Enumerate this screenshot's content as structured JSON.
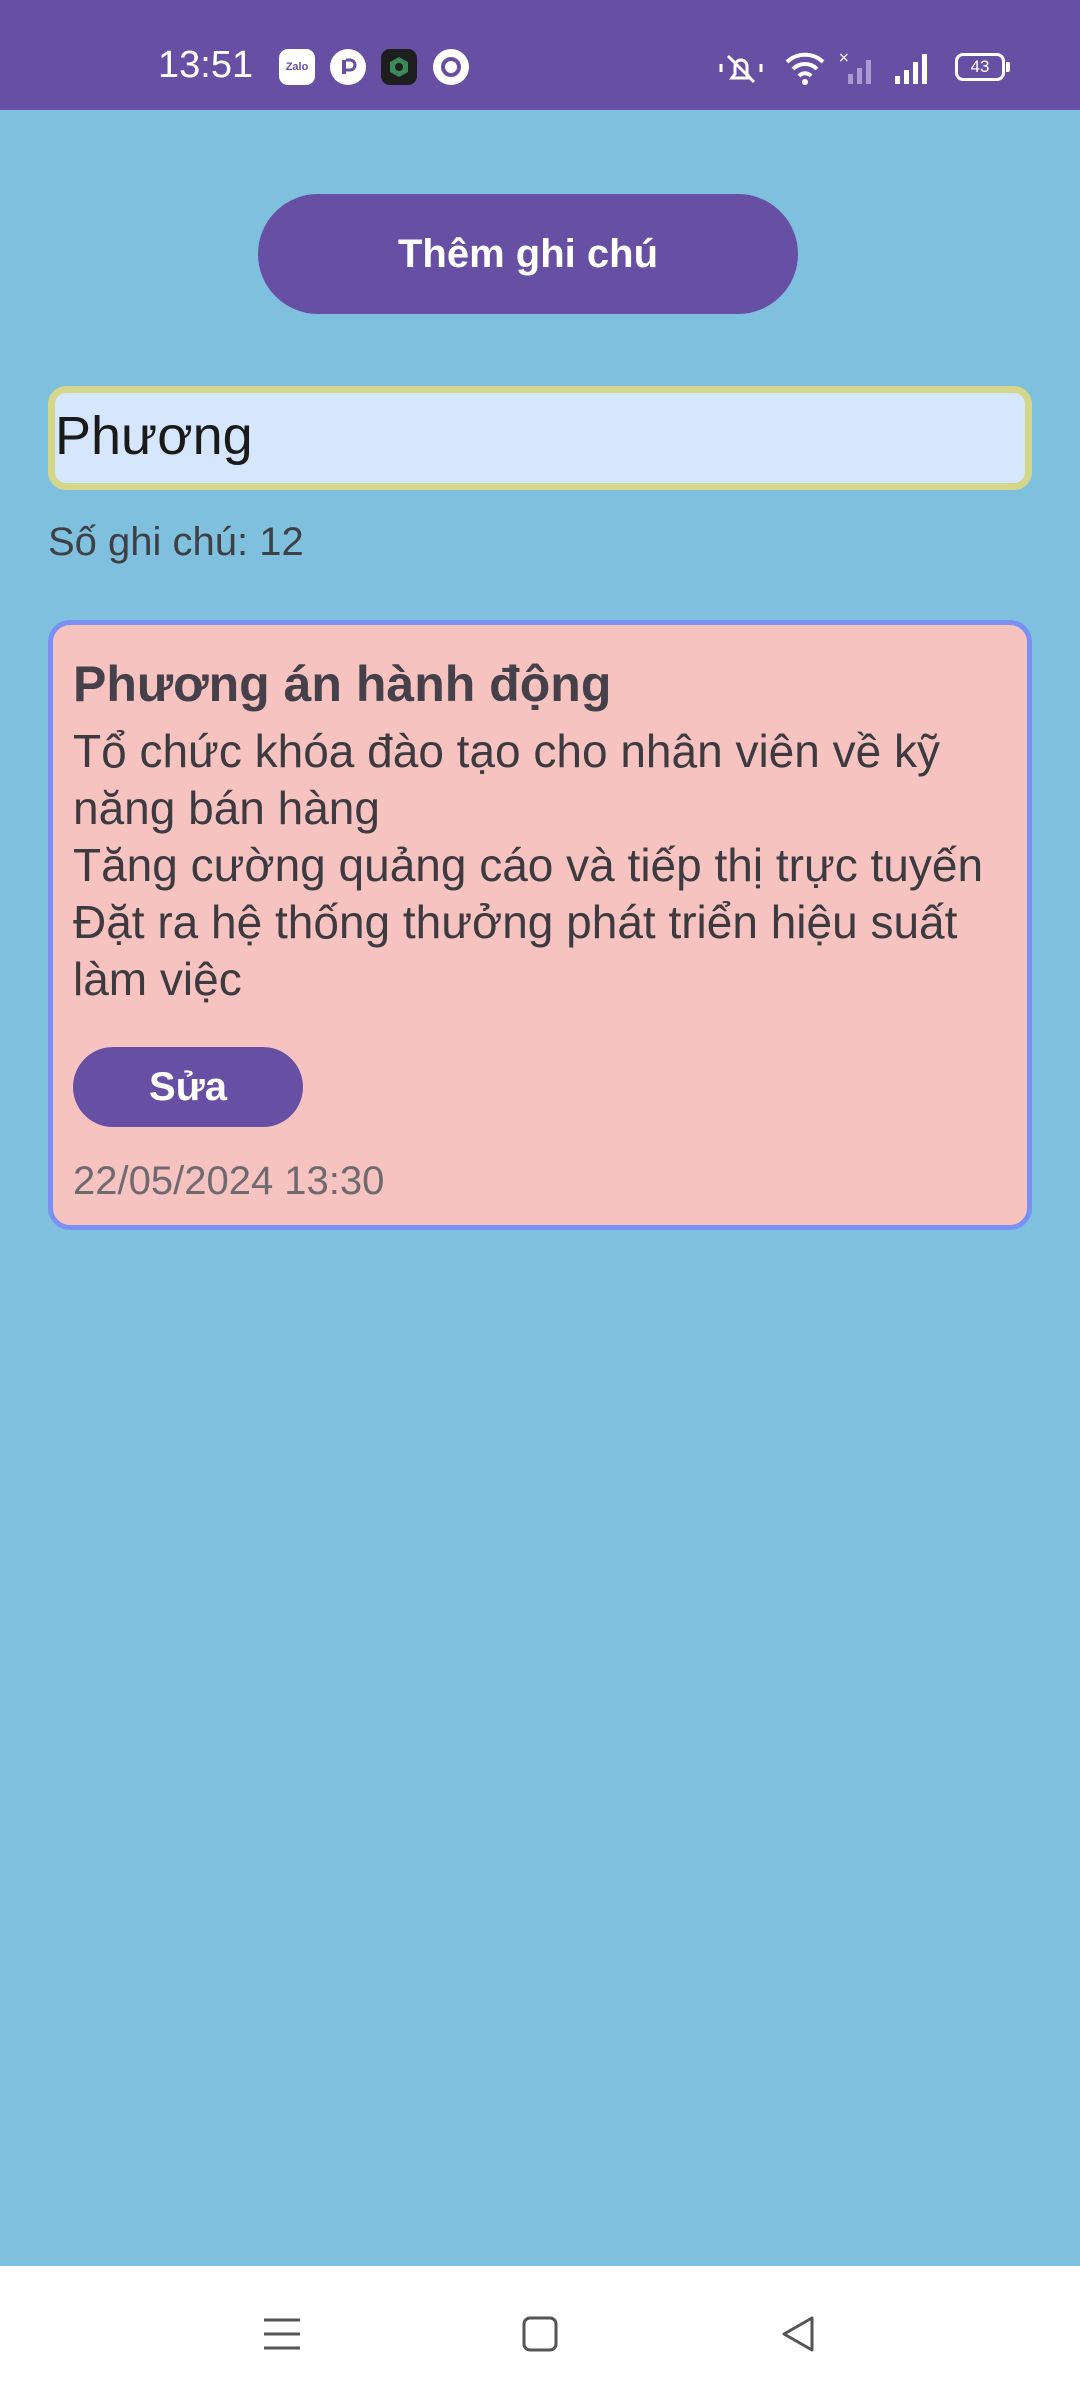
{
  "status_bar": {
    "time": "13:51",
    "battery": "43",
    "notification_icons": [
      "zalo-icon",
      "app-r-icon",
      "shield-app-icon",
      "sync-icon"
    ],
    "system_icons": [
      "mute-icon",
      "wifi-icon",
      "signal-off-icon",
      "signal-icon",
      "battery-icon"
    ],
    "zalo_label": "Zalo"
  },
  "toolbar": {
    "add_note_label": "Thêm ghi chú"
  },
  "search": {
    "value": "Phương"
  },
  "summary": {
    "note_count_label": "Số ghi chú: 12"
  },
  "notes": [
    {
      "title": "Phương án hành động",
      "lines": [
        "Tổ chức khóa đào tạo cho nhân viên về kỹ năng bán hàng",
        "Tăng cường quảng cáo và tiếp thị trực tuyến",
        "Đặt ra hệ thống thưởng phát triển hiệu suất làm việc"
      ],
      "edit_label": "Sửa",
      "date": "22/05/2024 13:30"
    }
  ],
  "nav_bar": {
    "icons": [
      "menu-icon",
      "home-icon",
      "back-icon"
    ]
  },
  "colors": {
    "primary": "#6750a4",
    "background": "#7fc0de",
    "card": "#f6c3c0",
    "card_border": "#7a90f2",
    "input_bg": "#d6e6fd",
    "input_border": "#d4d68a"
  }
}
